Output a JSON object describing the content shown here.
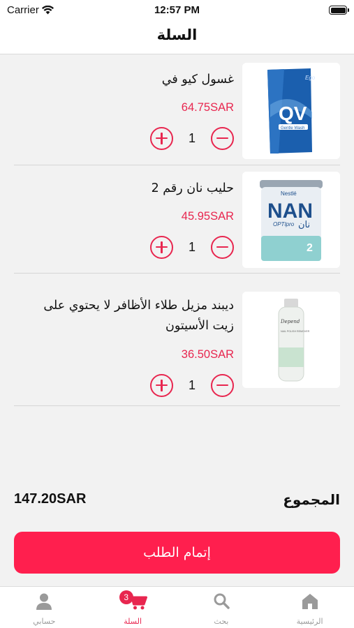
{
  "status_bar": {
    "carrier": "Carrier",
    "time": "12:57 PM"
  },
  "header": {
    "title": "السلة"
  },
  "cart": {
    "items": [
      {
        "name": "غسول كيو في",
        "price": "64.75SAR",
        "quantity": "1",
        "image_brand": "Ego",
        "image_logo": "QV",
        "image_caption": "Gentle Wash"
      },
      {
        "name": "حليب نان رقم 2",
        "price": "45.95SAR",
        "quantity": "1",
        "image_brand": "Nestlé",
        "image_logo": "NAN",
        "image_sub": "OPTIpro",
        "image_arabic": "نان",
        "image_stage": "2"
      },
      {
        "name": "ديبند مزيل طلاء الأظافر لا يحتوي على زيت الأسيتون",
        "price": "36.50SAR",
        "quantity": "1",
        "image_brand": "Depend",
        "image_caption": "NAIL POLISH REMOVER"
      }
    ]
  },
  "summary": {
    "total_label": "المجموع",
    "total_value": "147.20SAR"
  },
  "checkout": {
    "label": "إتمام الطلب"
  },
  "tab_bar": {
    "tabs": [
      {
        "label": "حسابي",
        "icon": "person-icon",
        "active": false
      },
      {
        "label": "السلة",
        "icon": "cart-icon",
        "active": true,
        "badge": "3"
      },
      {
        "label": "بحث",
        "icon": "search-icon",
        "active": false
      },
      {
        "label": "الرئيسية",
        "icon": "home-icon",
        "active": false
      }
    ]
  },
  "colors": {
    "accent": "#e8264f",
    "checkout": "#ff1f4e",
    "inactive": "#9a9a9a"
  }
}
